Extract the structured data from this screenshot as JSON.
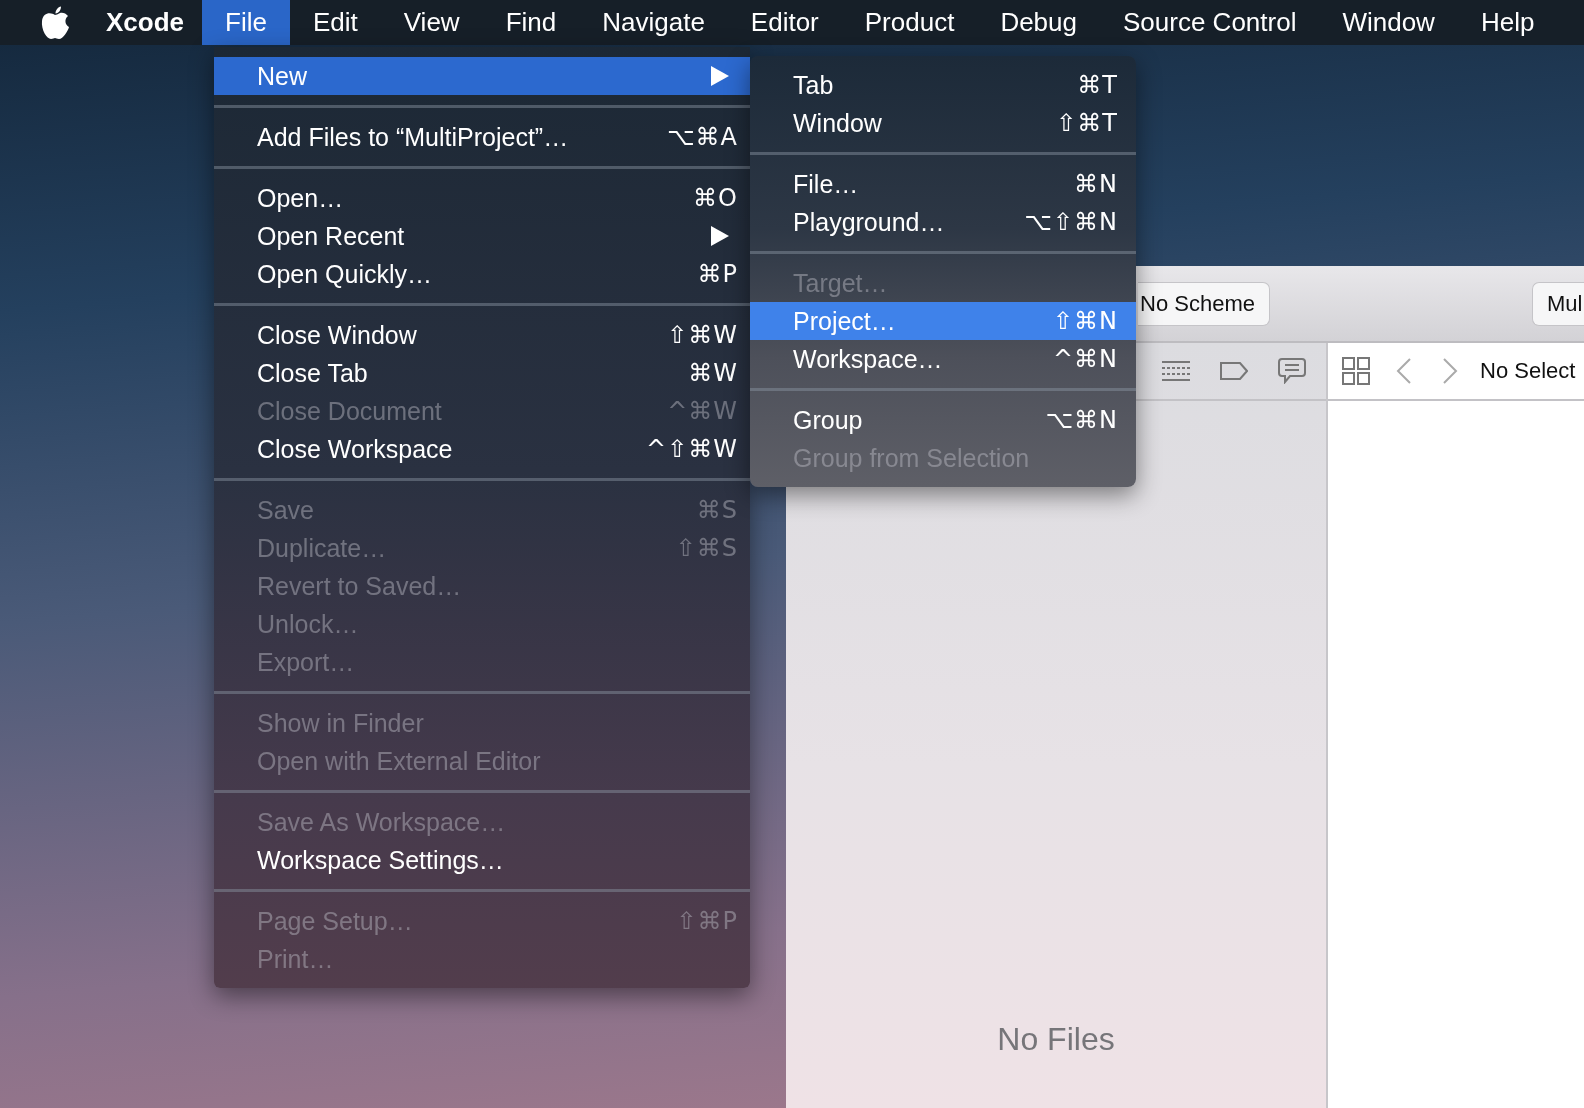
{
  "menu_bar": {
    "app_name": "Xcode",
    "menus": [
      {
        "label": "File",
        "selected": true
      },
      {
        "label": "Edit",
        "selected": false
      },
      {
        "label": "View",
        "selected": false
      },
      {
        "label": "Find",
        "selected": false
      },
      {
        "label": "Navigate",
        "selected": false
      },
      {
        "label": "Editor",
        "selected": false
      },
      {
        "label": "Product",
        "selected": false
      },
      {
        "label": "Debug",
        "selected": false
      },
      {
        "label": "Source Control",
        "selected": false
      },
      {
        "label": "Window",
        "selected": false
      },
      {
        "label": "Help",
        "selected": false
      }
    ]
  },
  "file_menu": {
    "sections": [
      {
        "items": [
          {
            "label": "New",
            "selected": true,
            "disabled": false,
            "submenu": true
          }
        ]
      },
      {
        "items": [
          {
            "label": "Add Files to “MultiProject”…",
            "shortcut": "⌥⌘A",
            "selected": false,
            "disabled": false
          }
        ]
      },
      {
        "items": [
          {
            "label": "Open…",
            "shortcut": "⌘O",
            "selected": false,
            "disabled": false
          },
          {
            "label": "Open Recent",
            "selected": false,
            "disabled": false,
            "submenu": true
          },
          {
            "label": "Open Quickly…",
            "shortcut": "⌘P",
            "selected": false,
            "disabled": false
          }
        ]
      },
      {
        "items": [
          {
            "label": "Close Window",
            "shortcut": "⇧⌘W",
            "selected": false,
            "disabled": false
          },
          {
            "label": "Close Tab",
            "shortcut": "⌘W",
            "selected": false,
            "disabled": false
          },
          {
            "label": "Close Document",
            "shortcut": "^⌘W",
            "selected": false,
            "disabled": true
          },
          {
            "label": "Close Workspace",
            "shortcut": "^⇧⌘W",
            "selected": false,
            "disabled": false
          }
        ]
      },
      {
        "items": [
          {
            "label": "Save",
            "shortcut": "⌘S",
            "selected": false,
            "disabled": true
          },
          {
            "label": "Duplicate…",
            "shortcut": "⇧⌘S",
            "selected": false,
            "disabled": true
          },
          {
            "label": "Revert to Saved…",
            "selected": false,
            "disabled": true
          },
          {
            "label": "Unlock…",
            "selected": false,
            "disabled": true
          },
          {
            "label": "Export…",
            "selected": false,
            "disabled": true
          }
        ]
      },
      {
        "items": [
          {
            "label": "Show in Finder",
            "selected": false,
            "disabled": true
          },
          {
            "label": "Open with External Editor",
            "selected": false,
            "disabled": true
          }
        ]
      },
      {
        "items": [
          {
            "label": "Save As Workspace…",
            "selected": false,
            "disabled": true
          },
          {
            "label": "Workspace Settings…",
            "selected": false,
            "disabled": false
          }
        ]
      },
      {
        "items": [
          {
            "label": "Page Setup…",
            "shortcut": "⇧⌘P",
            "selected": false,
            "disabled": true
          },
          {
            "label": "Print…",
            "selected": false,
            "disabled": true
          }
        ]
      }
    ]
  },
  "new_submenu": {
    "sections": [
      {
        "items": [
          {
            "label": "Tab",
            "shortcut": "⌘T",
            "selected": false,
            "disabled": false
          },
          {
            "label": "Window",
            "shortcut": "⇧⌘T",
            "selected": false,
            "disabled": false
          }
        ]
      },
      {
        "items": [
          {
            "label": "File…",
            "shortcut": "⌘N",
            "selected": false,
            "disabled": false
          },
          {
            "label": "Playground…",
            "shortcut": "⌥⇧⌘N",
            "selected": false,
            "disabled": false
          }
        ]
      },
      {
        "items": [
          {
            "label": "Target…",
            "selected": false,
            "disabled": true
          },
          {
            "label": "Project…",
            "shortcut": "⇧⌘N",
            "selected": true,
            "disabled": false
          },
          {
            "label": "Workspace…",
            "shortcut": "^⌘N",
            "selected": false,
            "disabled": false
          }
        ]
      },
      {
        "items": [
          {
            "label": "Group",
            "shortcut": "⌥⌘N",
            "selected": false,
            "disabled": false
          },
          {
            "label": "Group from Selection",
            "selected": false,
            "disabled": true
          }
        ]
      }
    ]
  },
  "xcode_window": {
    "toolbar": {
      "scheme_button": "No Scheme",
      "destination_button": "Mul"
    },
    "navigator": {
      "empty_message": "No Files"
    },
    "editor": {
      "jump_bar_text": "No Select"
    }
  }
}
